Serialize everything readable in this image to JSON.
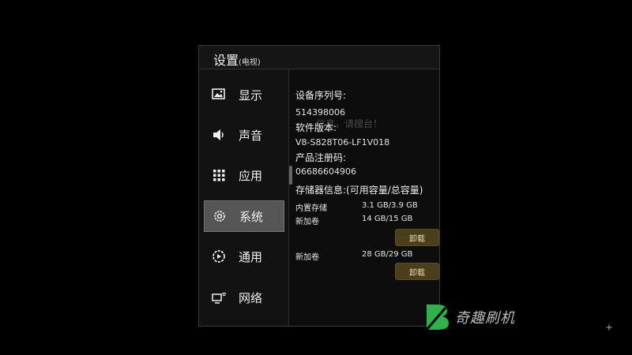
{
  "dialog": {
    "title": "设置",
    "title_sub": "(电视)"
  },
  "sidebar": {
    "items": [
      {
        "label": "显示",
        "icon": "display-icon"
      },
      {
        "label": "声音",
        "icon": "speaker-icon"
      },
      {
        "label": "应用",
        "icon": "apps-grid-icon"
      },
      {
        "label": "系统",
        "icon": "gear-icon",
        "active": true
      },
      {
        "label": "通用",
        "icon": "general-settings-icon"
      },
      {
        "label": "网络",
        "icon": "network-icon"
      }
    ]
  },
  "system": {
    "serial_label": "设备序列号:",
    "serial_value": "514398006",
    "software_label": "软件版本:",
    "software_value": "V8-S828T06-LF1V018",
    "product_label": "产品注册码:",
    "product_value": "06686604906",
    "storage_label": "存储器信息:(可用容量/总容量)",
    "storage": [
      {
        "name": "内置存储",
        "capacity": "3.1 GB/3.9 GB"
      },
      {
        "name": "新加卷",
        "capacity": "14 GB/15 GB",
        "button": "卸载"
      },
      {
        "name": "新加卷",
        "capacity": "28 GB/29 GB",
        "button": "卸载"
      }
    ]
  },
  "overlay": {
    "ghost_text": "信息，请搜台！"
  },
  "watermark": {
    "text": "奇趣刷机"
  },
  "colors": {
    "background": "#000000",
    "panel": "#0d0d0d",
    "active_item": "#555555",
    "unload_button": "#4a3e1c",
    "watermark_green": "#2db34a"
  }
}
